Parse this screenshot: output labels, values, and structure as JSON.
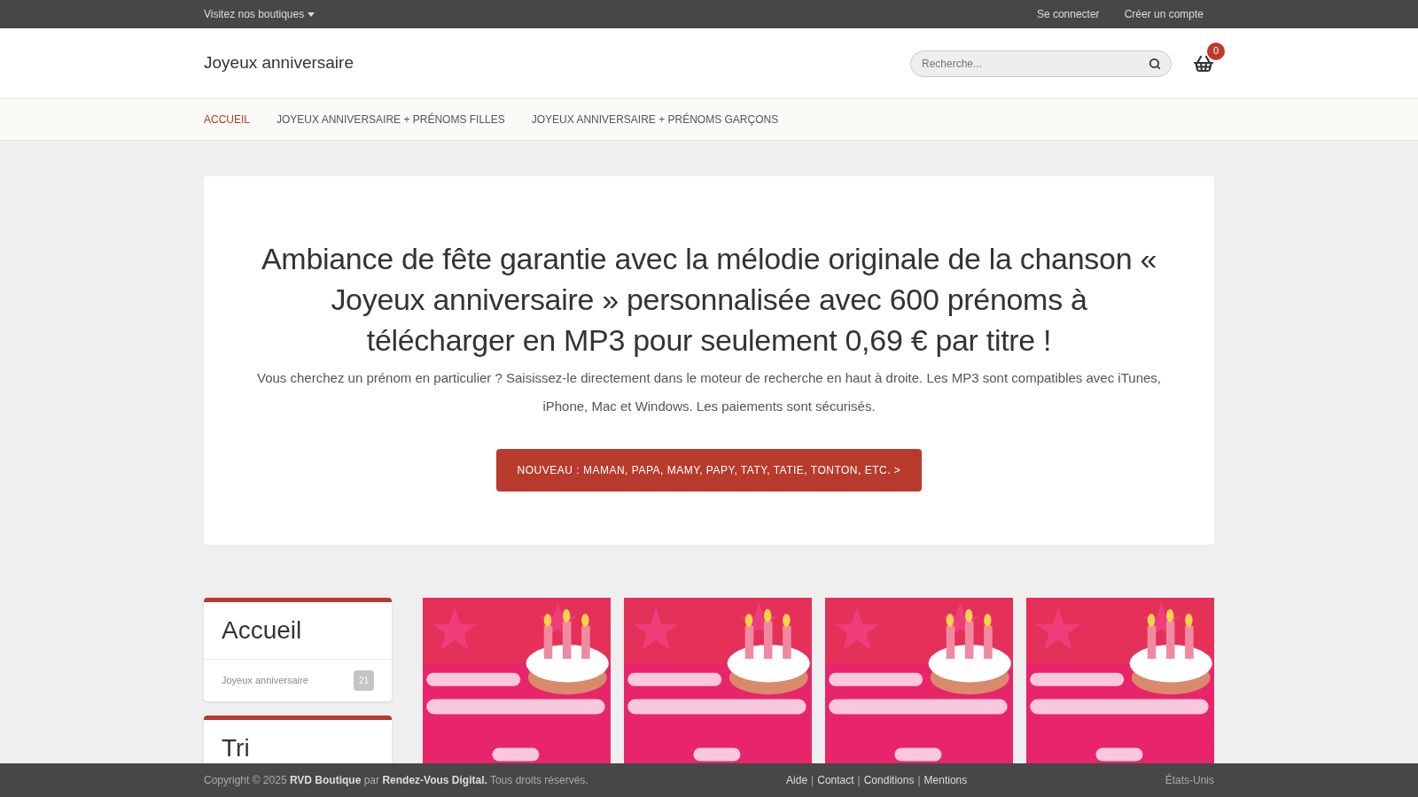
{
  "topbar": {
    "shops": "Visitez nos boutiques",
    "links": [
      "Se connecter",
      "Créer un compte"
    ]
  },
  "header": {
    "site_title": "Joyeux anniversaire",
    "search": {
      "placeholder": "Recherche..."
    },
    "cart_count": "0"
  },
  "nav": [
    {
      "label": "ACCUEIL",
      "selected": true
    },
    {
      "label": "JOYEUX ANNIVERSAIRE + PRÉNOMS FILLES",
      "selected": false
    },
    {
      "label": "JOYEUX ANNIVERSAIRE + PRÉNOMS GARÇONS",
      "selected": false
    }
  ],
  "hero": {
    "title": "Ambiance de fête garantie avec la mélodie originale de la chanson « Joyeux anniversaire » personnalisée avec 600 prénoms à télécharger en MP3 pour seulement 0,69 € par titre !",
    "text": "Vous cherchez un prénom en particulier ? Saisissez-le directement dans le moteur de recherche en haut à droite. Les MP3 sont compatibles avec iTunes, iPhone, Mac et Windows. Les paiements sont sécurisés.",
    "button": "NOUVEAU : MAMAN, PAPA, MAMY, PAPY, TATY, TATIE, TONTON, ETC. >"
  },
  "sidebar": [
    {
      "title": "Accueil",
      "items": [
        {
          "label": "Joyeux anniversaire",
          "count": "21"
        }
      ]
    },
    {
      "title": "Tri"
    }
  ],
  "footer": {
    "copyright": "Copyright © 2025 **RVD Boutique** par **Rendez-Vous Digital.** Tous droits réservés.",
    "links": [
      "Aide",
      "Contact",
      "Conditions",
      "Mentions"
    ],
    "separators": [
      "|",
      "|",
      "|"
    ],
    "country": "États-Unis"
  }
}
